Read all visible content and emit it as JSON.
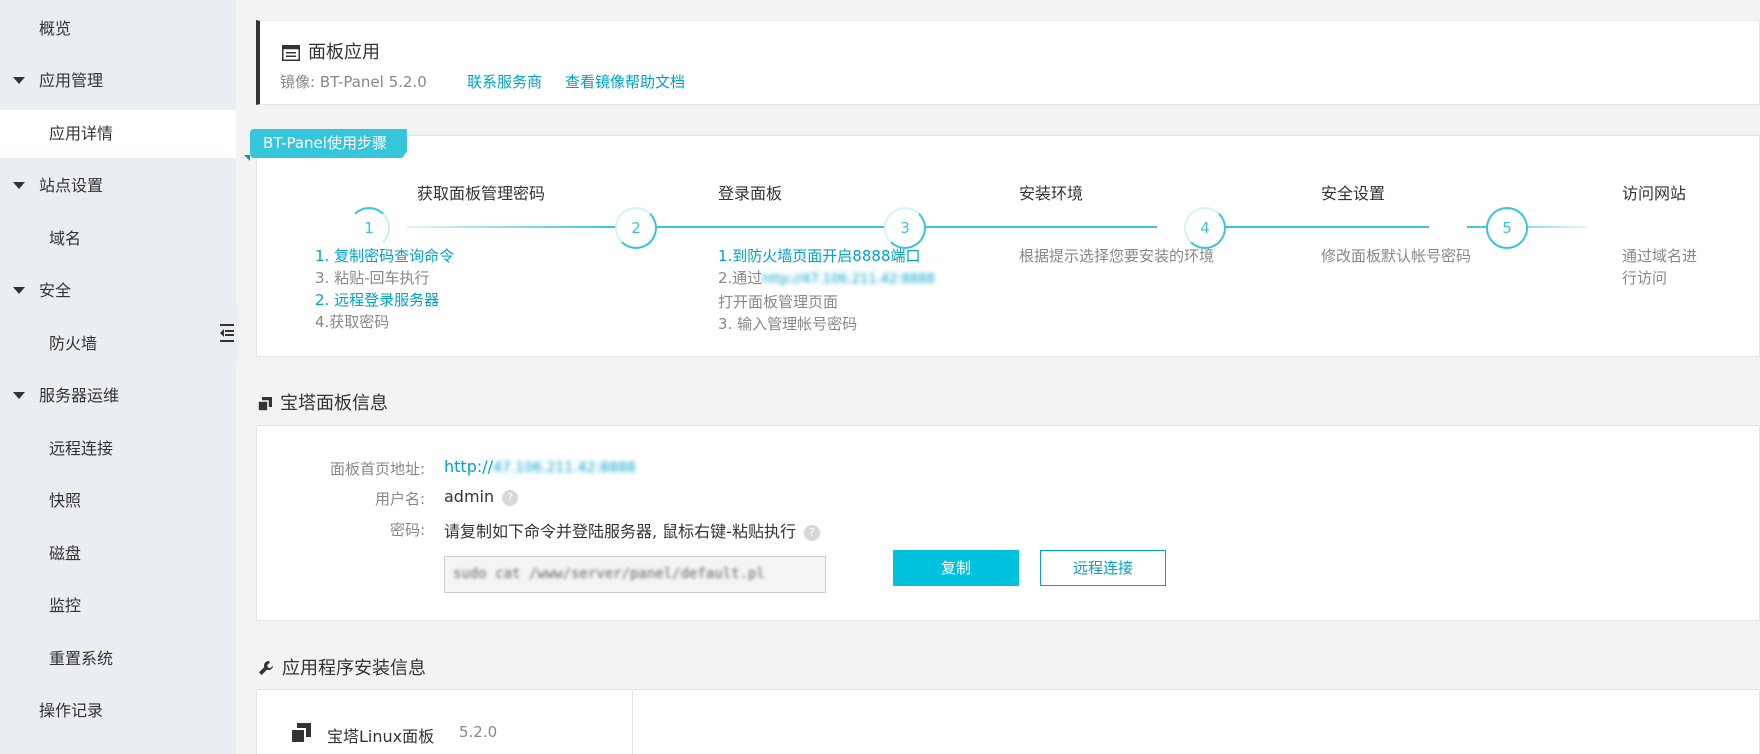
{
  "sidebar": {
    "overview": "概览",
    "app_mgmt": "应用管理",
    "app_detail": "应用详情",
    "site_settings": "站点设置",
    "domain": "域名",
    "security": "安全",
    "firewall": "防火墙",
    "server_ops": "服务器运维",
    "remote": "远程连接",
    "snapshot": "快照",
    "disk": "磁盘",
    "monitor": "监控",
    "reset": "重置系统",
    "log": "操作记录"
  },
  "panel_app": {
    "title": "面板应用",
    "image_label": "镜像:",
    "image_value": "BT-Panel 5.2.0",
    "contact_link": "联系服务商",
    "help_link": "查看镜像帮助文档"
  },
  "steps": {
    "ribbon": "BT-Panel使用步骤",
    "items": [
      {
        "num": "1",
        "title": "获取面板管理密码",
        "lines": [
          "1. 复制密码查询命令",
          "3. 粘贴-回车执行",
          "2. 远程登录服务器",
          "4.获取密码"
        ]
      },
      {
        "num": "2",
        "title": "登录面板",
        "lines": [
          "1.到防火墙页面开启8888端口",
          "2.通过",
          "http://47.106.211.42:8888",
          "打开面板管理页面",
          "3. 输入管理帐号密码"
        ]
      },
      {
        "num": "3",
        "title": "安装环境",
        "lines": [
          "根据提示选择您要安装的环境"
        ]
      },
      {
        "num": "4",
        "title": "安全设置",
        "lines": [
          "修改面板默认帐号密码"
        ]
      },
      {
        "num": "5",
        "title": "访问网站",
        "lines": [
          "通过域名进",
          "行访问"
        ]
      }
    ]
  },
  "panel_info": {
    "heading": "宝塔面板信息",
    "url_label": "面板首页地址:",
    "url_prefix": "http://",
    "url_rest": "47.106.211.42:8888",
    "user_label": "用户名:",
    "user_value": "admin",
    "pwd_label": "密码:",
    "pwd_value": "请复制如下命令并登陆服务器, 鼠标右键-粘贴执行",
    "command": "sudo cat /www/server/panel/default.pl",
    "copy_btn": "复制",
    "remote_btn": "远程连接"
  },
  "install": {
    "heading": "应用程序安装信息",
    "name": "宝塔Linux面板",
    "version": "5.2.0"
  },
  "colors": {
    "accent": "#37c5dc",
    "link": "#00a2ca",
    "button": "#00c1de"
  }
}
